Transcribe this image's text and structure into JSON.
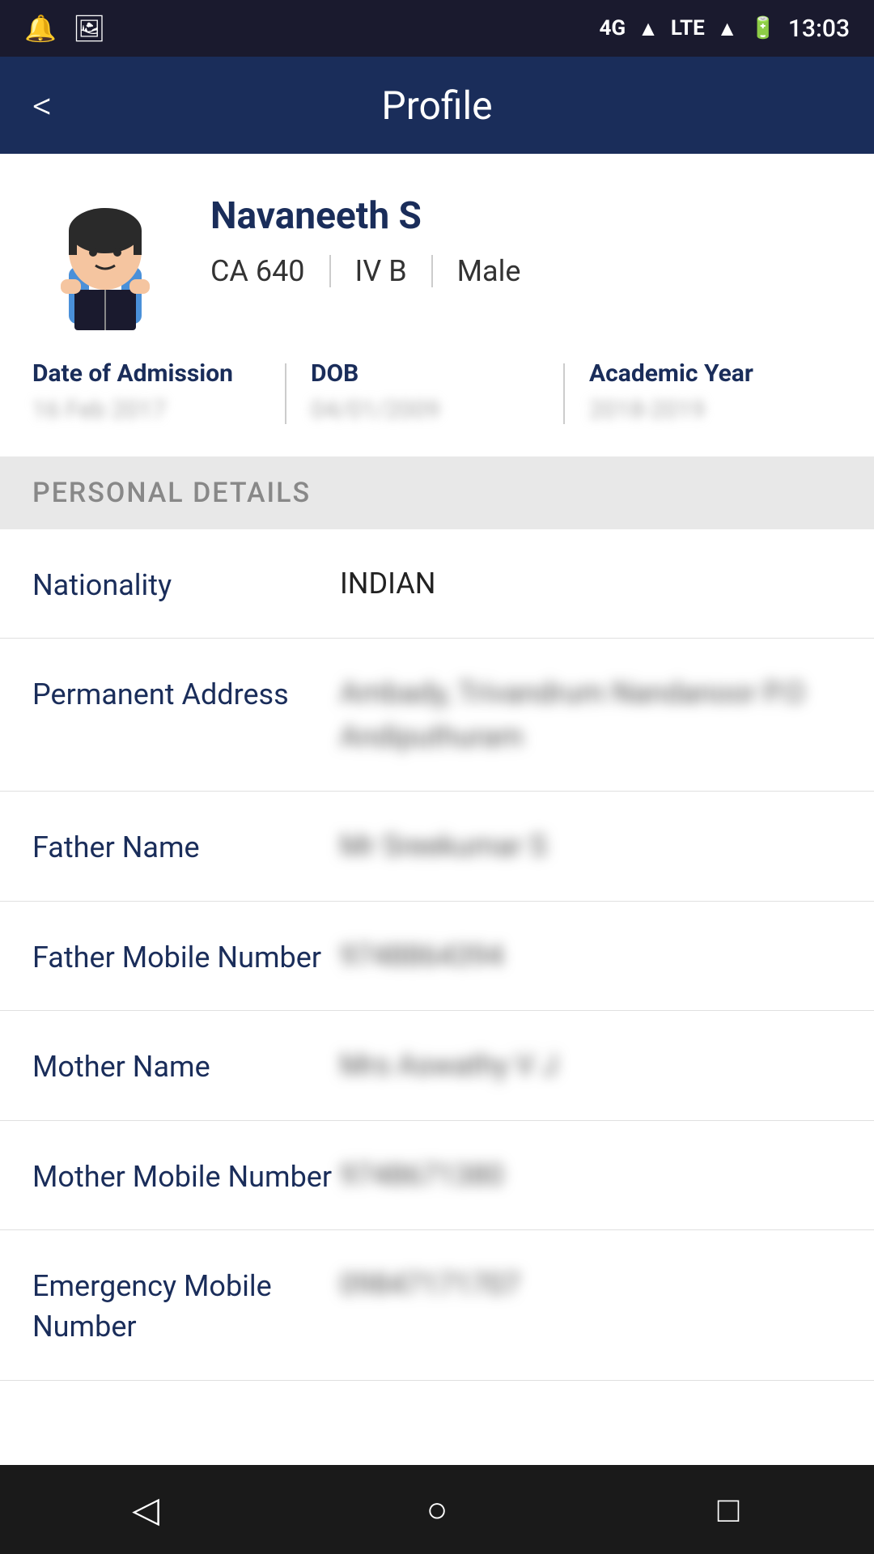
{
  "statusBar": {
    "time": "13:03",
    "network": "4G",
    "carrier": "LTE"
  },
  "appBar": {
    "title": "Profile",
    "backLabel": "<"
  },
  "profile": {
    "name": "Navaneeth S",
    "rollNumber": "CA 640",
    "section": "IV B",
    "gender": "Male",
    "dateOfAdmission": {
      "label": "Date of Admission",
      "value": "16 Feb 2017"
    },
    "dob": {
      "label": "DOB",
      "value": "04/01/2009"
    },
    "academicYear": {
      "label": "Academic Year",
      "value": "2018-2019"
    }
  },
  "personalDetails": {
    "sectionTitle": "PERSONAL DETAILS",
    "fields": [
      {
        "label": "Nationality",
        "value": "INDIAN",
        "blurred": false
      },
      {
        "label": "Permanent Address",
        "value": "Ambady, Trivandrum\nNandanoor P.O\nAndiputhuram",
        "blurred": true
      },
      {
        "label": "Father Name",
        "value": "Mr Sreekumar S",
        "blurred": true
      },
      {
        "label": "Father Mobile Number",
        "value": "9748864394",
        "blurred": true
      },
      {
        "label": "Mother Name",
        "value": "Mrs Aswathy V J",
        "blurred": true
      },
      {
        "label": "Mother Mobile Number",
        "value": "9748671380",
        "blurred": true
      },
      {
        "label": "Emergency Mobile Number",
        "value": "09847171707",
        "blurred": true
      }
    ]
  },
  "bottomNav": {
    "backIcon": "◁",
    "homeIcon": "○",
    "recentIcon": "□"
  }
}
